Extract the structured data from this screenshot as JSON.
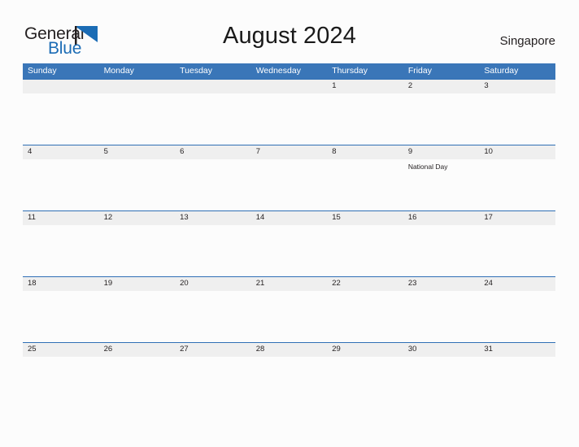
{
  "branding": {
    "name_part1": "General",
    "name_part2": "Blue",
    "flag_icon": "blue-triangle-flag-icon",
    "accent_color": "#1b6cb5"
  },
  "header": {
    "title": "August 2024",
    "country": "Singapore"
  },
  "colors": {
    "header_blue": "#3a76b8",
    "band_gray": "#efefef",
    "band_border": "#2f6fb5",
    "text": "#231f20",
    "background": "#fcfcfc"
  },
  "calendar": {
    "weekdays": [
      "Sunday",
      "Monday",
      "Tuesday",
      "Wednesday",
      "Thursday",
      "Friday",
      "Saturday"
    ],
    "weeks": [
      [
        {
          "day": ""
        },
        {
          "day": ""
        },
        {
          "day": ""
        },
        {
          "day": ""
        },
        {
          "day": "1"
        },
        {
          "day": "2"
        },
        {
          "day": "3"
        }
      ],
      [
        {
          "day": "4"
        },
        {
          "day": "5"
        },
        {
          "day": "6"
        },
        {
          "day": "7"
        },
        {
          "day": "8"
        },
        {
          "day": "9",
          "event": "National Day"
        },
        {
          "day": "10"
        }
      ],
      [
        {
          "day": "11"
        },
        {
          "day": "12"
        },
        {
          "day": "13"
        },
        {
          "day": "14"
        },
        {
          "day": "15"
        },
        {
          "day": "16"
        },
        {
          "day": "17"
        }
      ],
      [
        {
          "day": "18"
        },
        {
          "day": "19"
        },
        {
          "day": "20"
        },
        {
          "day": "21"
        },
        {
          "day": "22"
        },
        {
          "day": "23"
        },
        {
          "day": "24"
        }
      ],
      [
        {
          "day": "25"
        },
        {
          "day": "26"
        },
        {
          "day": "27"
        },
        {
          "day": "28"
        },
        {
          "day": "29"
        },
        {
          "day": "30"
        },
        {
          "day": "31"
        }
      ]
    ]
  }
}
